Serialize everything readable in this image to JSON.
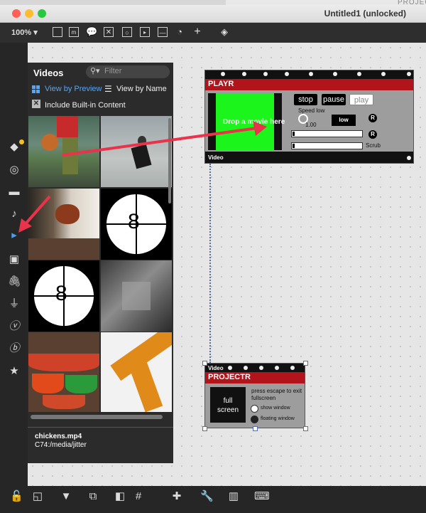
{
  "window": {
    "title": "Untitled1 (unlocked)",
    "background_window_title": "PROJEC"
  },
  "toolbar": {
    "zoom": "100%"
  },
  "browser": {
    "title": "Videos",
    "search_placeholder": "Filter",
    "view_by_preview": "View by Preview",
    "view_by_name": "View by Name",
    "include_builtin": "Include Built-in Content",
    "selected_file": "chickens.mp4",
    "selected_path": "C74:/media/jitter"
  },
  "playr": {
    "title": "PLAYR",
    "drop_text": "Drop a movie here",
    "stop": "stop",
    "pause": "pause",
    "play": "play",
    "speed_label": "Speed low",
    "speed_value": "1.00",
    "low_label": "low",
    "r_label": "R",
    "scrub_label": "Scrub",
    "footer": "Video"
  },
  "projectr": {
    "header": "Video",
    "title": "PROJECTR",
    "full_screen": "full screen",
    "escape_hint": "press escape to exit fullscreen",
    "show_window": "show window",
    "floating_window": "floating window"
  },
  "colors": {
    "accent_red": "#b1141a",
    "drop_green": "#1bf51b",
    "arrow_red": "#e8334a",
    "link_blue": "#5aa5f0"
  }
}
